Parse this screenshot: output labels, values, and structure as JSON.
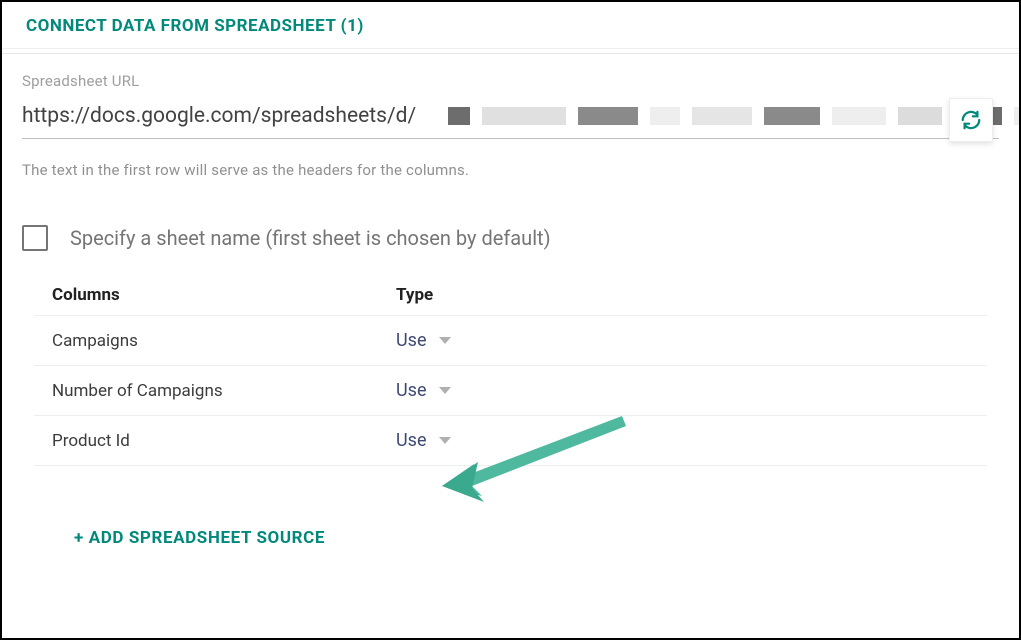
{
  "header": {
    "title": "CONNECT DATA FROM SPREADSHEET (1)"
  },
  "url_field": {
    "label": "Spreadsheet URL",
    "value": "https://docs.google.com/spreadsheets/d/"
  },
  "hint": "The text in the first row will serve as the headers for the columns.",
  "sheet_checkbox": {
    "label": "Specify a sheet name (first sheet is chosen by default)"
  },
  "columns_table": {
    "head_columns": "Columns",
    "head_type": "Type",
    "rows": [
      {
        "name": "Campaigns",
        "type": "Use"
      },
      {
        "name": "Number of Campaigns",
        "type": "Use"
      },
      {
        "name": "Product Id",
        "type": "Use"
      }
    ]
  },
  "add_source_label": "+ ADD SPREADSHEET SOURCE"
}
